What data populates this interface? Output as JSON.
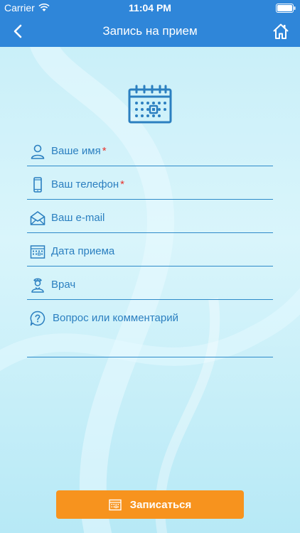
{
  "status_bar": {
    "carrier": "Carrier",
    "time": "11:04 PM"
  },
  "navbar": {
    "title": "Запись на прием",
    "back_icon": "chevron-left-icon",
    "home_icon": "home-icon"
  },
  "form": {
    "fields": [
      {
        "label": "Ваше имя",
        "required_mark": "*",
        "icon": "user-icon"
      },
      {
        "label": "Ваш телефон",
        "required_mark": "*",
        "icon": "phone-icon"
      },
      {
        "label": "Ваш e-mail",
        "required_mark": "",
        "icon": "envelope-icon"
      },
      {
        "label": "Дата приема",
        "required_mark": "",
        "icon": "calendar-icon"
      },
      {
        "label": "Врач",
        "required_mark": "",
        "icon": "doctor-icon"
      },
      {
        "label": "Вопрос или комментарий",
        "required_mark": "",
        "icon": "question-icon"
      }
    ]
  },
  "submit": {
    "label": "Записаться",
    "icon": "calendar-icon"
  },
  "colors": {
    "nav_bg": "#2f86d9",
    "accent": "#2b7fc0",
    "required": "#e8322b",
    "button": "#f7931e"
  }
}
